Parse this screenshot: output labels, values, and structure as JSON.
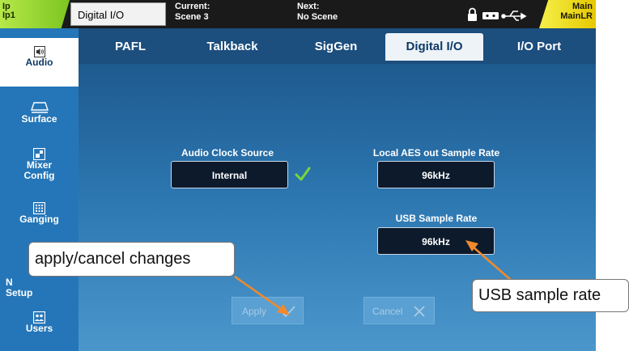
{
  "top_bar": {
    "ip_label_1": "Ip",
    "ip_label_2": "Ip1",
    "screen_name": "Digital I/O",
    "current_label": "Current:",
    "current_scene": "Scene 3",
    "next_label": "Next:",
    "next_scene": "No Scene",
    "main_label_1": "Main",
    "main_label_2": "MainLR",
    "ip_color": "#8cd42a",
    "main_color": "#f2e21a"
  },
  "sidebar": {
    "items": [
      {
        "label": "Audio",
        "icon": "speaker-icon",
        "active": true
      },
      {
        "label": "Surface",
        "icon": "surface-icon"
      },
      {
        "label_1": "Mixer",
        "label_2": "Config",
        "icon": "mixer-config-icon"
      },
      {
        "label": "Ganging",
        "icon": "ganging-icon"
      },
      {
        "label_1": "N",
        "label_2": "Setup",
        "icon": "network-icon"
      },
      {
        "label": "Users",
        "icon": "users-icon"
      }
    ]
  },
  "tabs": [
    {
      "label": "PAFL"
    },
    {
      "label": "Talkback"
    },
    {
      "label": "SigGen"
    },
    {
      "label": "Digital I/O",
      "active": true
    },
    {
      "label": "I/O Port"
    }
  ],
  "settings": {
    "audio_clock_source_label": "Audio Clock Source",
    "audio_clock_source_value": "Internal",
    "local_aes_label": "Local AES out Sample Rate",
    "local_aes_value": "96kHz",
    "usb_label": "USB Sample Rate",
    "usb_value": "96kHz",
    "check_color": "#7bd63a"
  },
  "actions": {
    "apply_label": "Apply",
    "cancel_label": "Cancel"
  },
  "callouts": {
    "apply_cancel": "apply/cancel changes",
    "usb_rate": "USB sample rate",
    "arrow_color": "#f08a2c"
  }
}
